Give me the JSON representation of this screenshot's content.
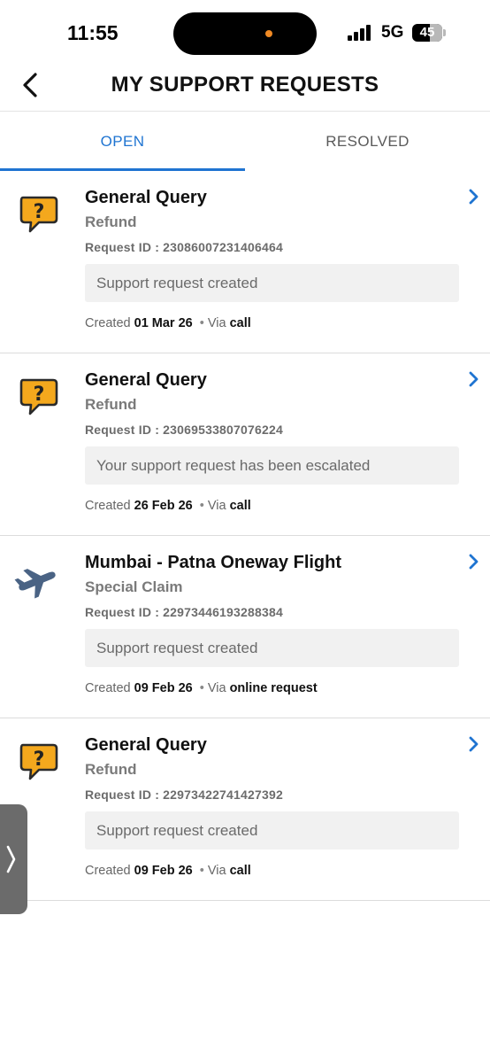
{
  "status_bar": {
    "time": "11:55",
    "network": "5G",
    "battery": "45"
  },
  "header": {
    "title": "MY SUPPORT REQUESTS",
    "back_icon": "chevron-left-icon"
  },
  "tabs": [
    {
      "label": "OPEN",
      "active": true
    },
    {
      "label": "RESOLVED",
      "active": false
    }
  ],
  "colors": {
    "accent": "#1f74d1",
    "chat_icon": "#f4a81d",
    "flight_icon": "#4a6384"
  },
  "requests": [
    {
      "icon": "question-chat-icon",
      "title": "General Query",
      "subtitle": "Refund",
      "request_id": "Request ID : 23086007231406464",
      "status": "Support request created",
      "created_prefix": "Created",
      "created_date": "01 Mar 26",
      "via_prefix": "Via",
      "via": "call"
    },
    {
      "icon": "question-chat-icon",
      "title": "General Query",
      "subtitle": "Refund",
      "request_id": "Request ID : 23069533807076224",
      "status": "Your support request has been escalated",
      "created_prefix": "Created",
      "created_date": "26 Feb 26",
      "via_prefix": "Via",
      "via": "call"
    },
    {
      "icon": "airplane-icon",
      "title": "Mumbai - Patna Oneway Flight",
      "subtitle": "Special Claim",
      "request_id": "Request ID : 22973446193288384",
      "status": "Support request created",
      "created_prefix": "Created",
      "created_date": "09 Feb 26",
      "via_prefix": "Via",
      "via": "online request"
    },
    {
      "icon": "question-chat-icon",
      "title": "General Query",
      "subtitle": "Refund",
      "request_id": "Request ID : 22973422741427392",
      "status": "Support request created",
      "created_prefix": "Created",
      "created_date": "09 Feb 26",
      "via_prefix": "Via",
      "via": "call"
    }
  ]
}
